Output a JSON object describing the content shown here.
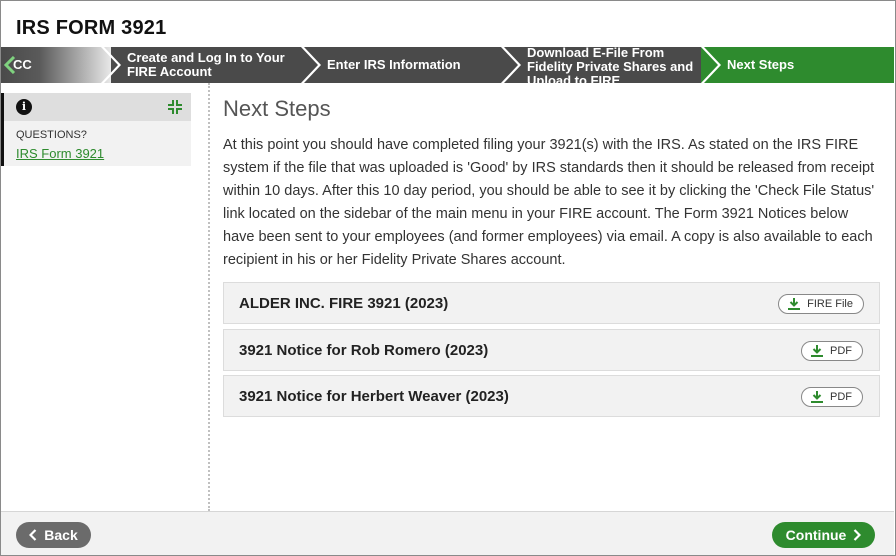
{
  "page": {
    "title": "IRS FORM 3921"
  },
  "steps": [
    {
      "label": "CC",
      "state": "previous"
    },
    {
      "label": "Create and Log In to Your FIRE Account",
      "state": "completed"
    },
    {
      "label": "Enter IRS Information",
      "state": "completed"
    },
    {
      "label": "Download E-File From Fidelity Private Shares and Upload to FIRE",
      "state": "completed"
    },
    {
      "label": "Next Steps",
      "state": "active"
    }
  ],
  "sidebar": {
    "info_icon": "info-circle-icon",
    "collapse_icon": "collapse-arrows-icon",
    "questions_label": "QUESTIONS?",
    "link": "IRS Form 3921"
  },
  "main": {
    "heading": "Next Steps",
    "paragraph": "At this point you should have completed filing your 3921(s) with the IRS. As stated on the IRS FIRE system if the file that was uploaded is 'Good' by IRS standards then it should be released from receipt within 10 days. After this 10 day period, you should be able to see it by clicking the 'Check File Status' link located on the sidebar of the main menu in your FIRE account. The Form 3921 Notices below have been sent to your employees (and former employees) via email. A copy is also available to each recipient in his or her Fidelity Private Shares account.",
    "documents": [
      {
        "title": "ALDER INC. FIRE 3921 (2023)",
        "button": "FIRE File"
      },
      {
        "title": "3921 Notice for Rob Romero (2023)",
        "button": "PDF"
      },
      {
        "title": "3921 Notice for Herbert Weaver (2023)",
        "button": "PDF"
      }
    ]
  },
  "footer": {
    "back_label": "Back",
    "continue_label": "Continue"
  },
  "colors": {
    "brand_green": "#2e8b2e",
    "step_gray": "#4a4a4a",
    "back_gray": "#6b6b6b"
  }
}
